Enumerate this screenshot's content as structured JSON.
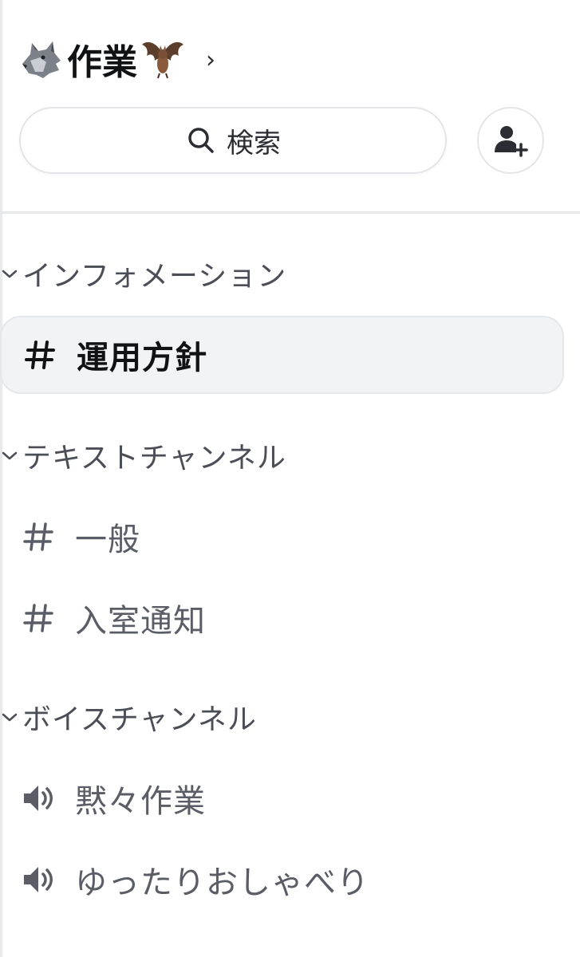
{
  "server": {
    "name": "作業",
    "left_emoji": "wolf-emoji",
    "right_emoji": "bat-emoji",
    "chevron": "›"
  },
  "search": {
    "label": "検索",
    "icon": "search-icon"
  },
  "invite": {
    "icon": "add-member-icon"
  },
  "categories": [
    {
      "label": "インフォメーション",
      "channels": [
        {
          "label": "運用方針",
          "type": "text",
          "selected": true
        }
      ]
    },
    {
      "label": "テキストチャンネル",
      "channels": [
        {
          "label": "一般",
          "type": "text",
          "selected": false
        },
        {
          "label": "入室通知",
          "type": "text",
          "selected": false
        }
      ]
    },
    {
      "label": "ボイスチャンネル",
      "channels": [
        {
          "label": "黙々作業",
          "type": "voice",
          "selected": false
        },
        {
          "label": "ゆったりおしゃべり",
          "type": "voice",
          "selected": false
        }
      ]
    }
  ],
  "colors": {
    "selected_background": "#f2f3f5",
    "channel_text": "#5a5d66",
    "selected_text": "#111214",
    "category_text": "#4c4e57"
  }
}
